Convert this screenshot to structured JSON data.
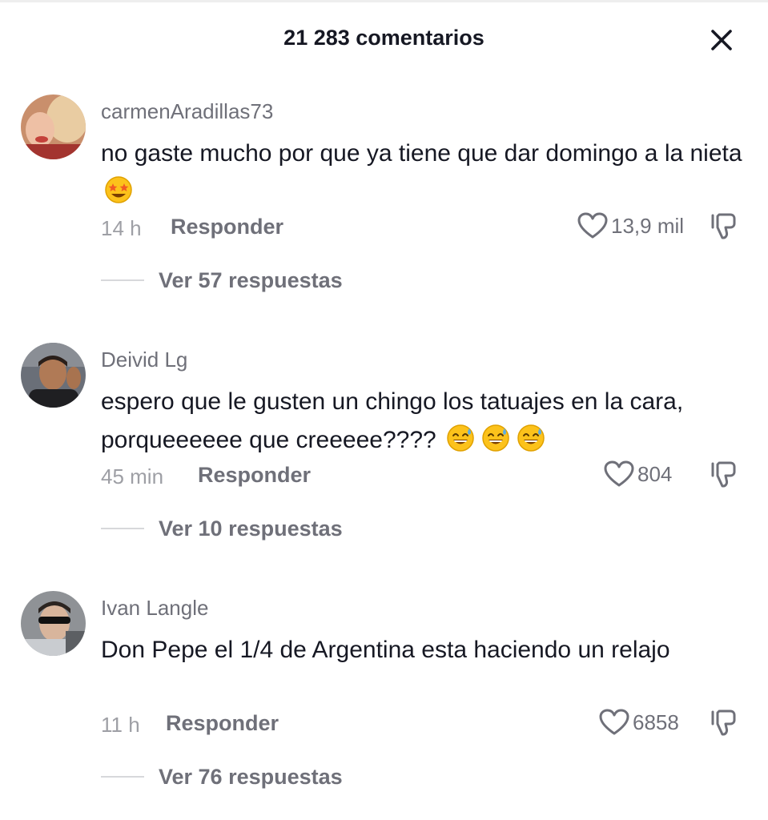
{
  "header": {
    "title": "21 283 comentarios",
    "close_icon": "close-icon"
  },
  "comments": [
    {
      "username": "carmenAradillas73",
      "text": "no gaste mucho por que ya tiene que dar domingo a la nieta",
      "emojis": [
        "star-struck-emoji"
      ],
      "time": "14 h",
      "reply_label": "Responder",
      "likes": "13,9 mil",
      "replies_label": "Ver 57 respuestas"
    },
    {
      "username": "Deivid Lg",
      "text": "espero que le gusten un chingo los tatuajes en la cara, porqueeeeee que creeeee????",
      "emojis": [
        "sweat-smile-emoji",
        "sweat-smile-emoji",
        "sweat-smile-emoji"
      ],
      "time": "45 min",
      "reply_label": "Responder",
      "likes": "804",
      "replies_label": "Ver 10 respuestas"
    },
    {
      "username": "Ivan Langle",
      "text": "Don Pepe el 1/4 de Argentina esta haciendo un relajo",
      "emojis": [],
      "time": "11 h",
      "reply_label": "Responder",
      "likes": "6858",
      "replies_label": "Ver 76 respuestas"
    }
  ],
  "colors": {
    "primary_text": "#161823",
    "secondary_text": "#6f7079",
    "muted_text": "#9e9fa5"
  }
}
